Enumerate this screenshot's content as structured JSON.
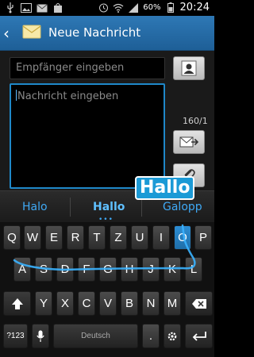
{
  "status_bar": {
    "battery_percent": "60%",
    "time": "20:24"
  },
  "header": {
    "title": "Neue Nachricht"
  },
  "compose": {
    "recipient_placeholder": "Empfänger eingeben",
    "message_placeholder": "Nachricht eingeben",
    "char_counter": "160/1"
  },
  "suggestions": {
    "items": [
      "Halo",
      "Hallo",
      "Galopp"
    ],
    "gesture_word": "Hallo",
    "dots": "•••"
  },
  "keyboard": {
    "row1": [
      "Q",
      "W",
      "E",
      "R",
      "T",
      "Z",
      "U",
      "I",
      "O",
      "P"
    ],
    "row2": [
      "A",
      "S",
      "D",
      "F",
      "G",
      "H",
      "J",
      "K",
      "L"
    ],
    "row3": [
      "Y",
      "X",
      "C",
      "V",
      "B",
      "N",
      "M"
    ],
    "sym_label": "?123",
    "space_label": "Deutsch",
    "highlighted_key": "O"
  },
  "colors": {
    "accent": "#1f88c9",
    "title_bar": "#2e78b5",
    "suggestion_text": "#3fa9f5"
  }
}
